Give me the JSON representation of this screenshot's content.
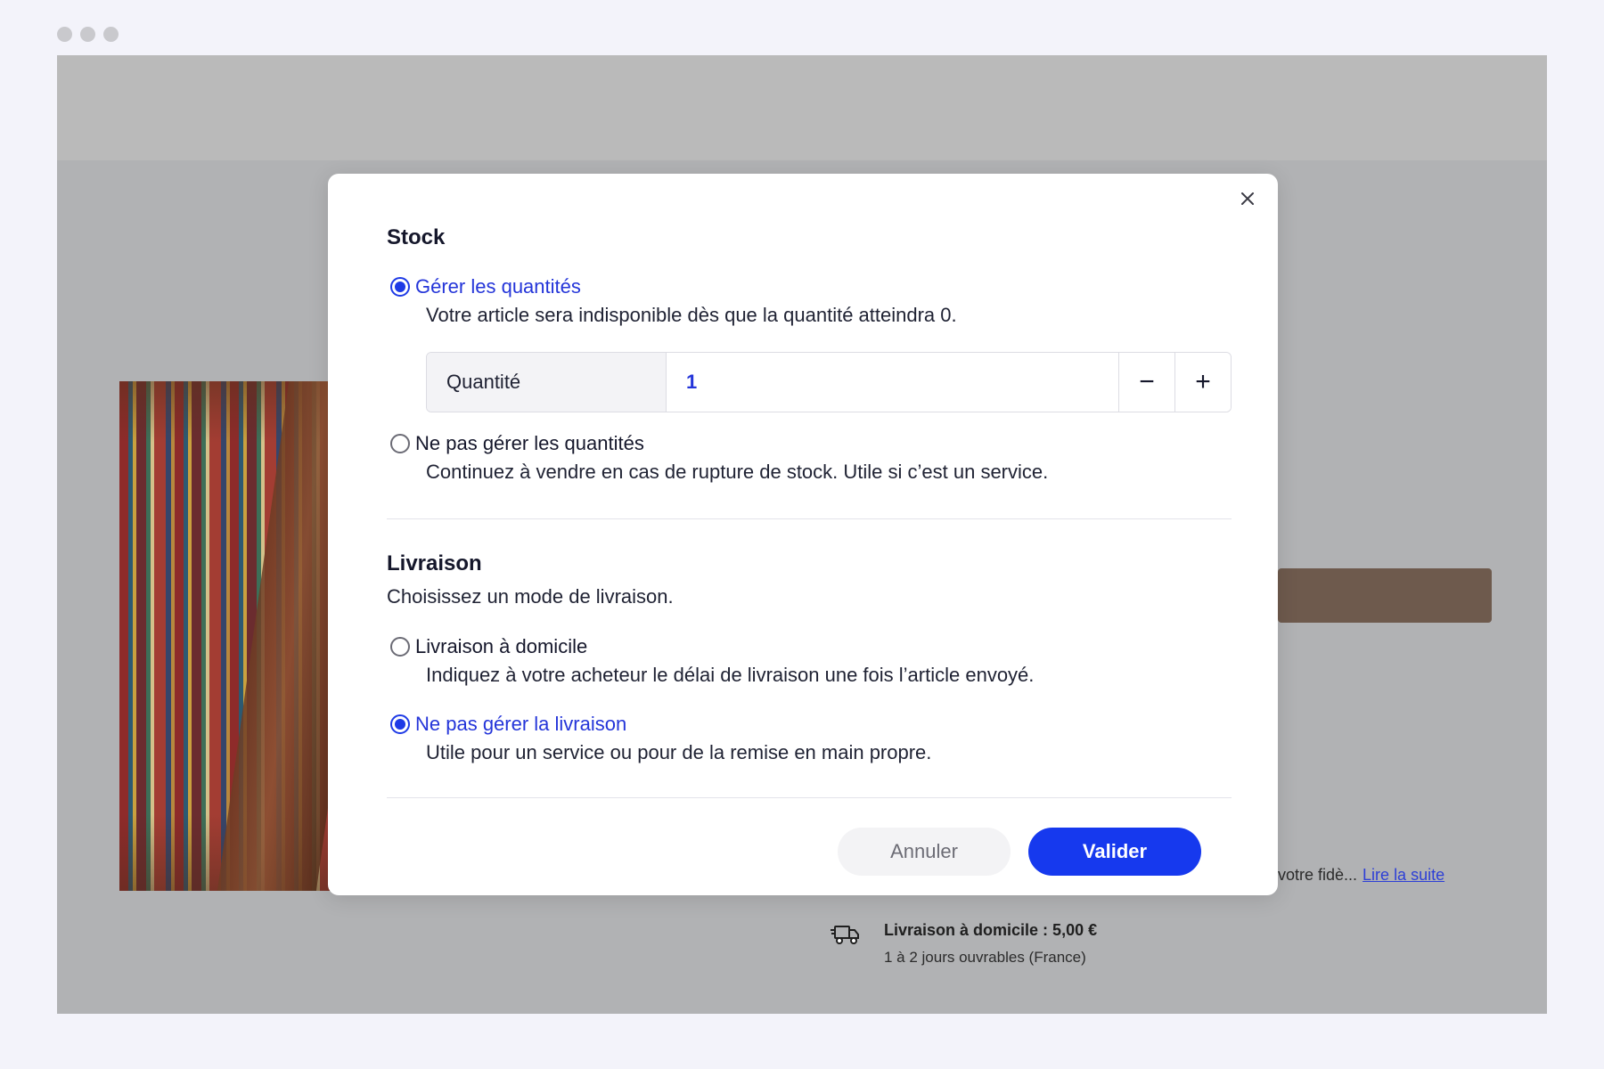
{
  "modal": {
    "stock": {
      "title": "Stock",
      "option_manage": {
        "label": "Gérer les quantités",
        "description": "Votre article sera indisponible dès que la quantité atteindra 0.",
        "checked": true
      },
      "quantity": {
        "label": "Quantité",
        "value": "1",
        "minus": "−",
        "plus": "+"
      },
      "option_no_manage": {
        "label": "Ne pas gérer les quantités",
        "description": "Continuez à vendre en cas de rupture de stock. Utile si c’est un service.",
        "checked": false
      }
    },
    "delivery": {
      "title": "Livraison",
      "subtitle": "Choisissez un mode de livraison.",
      "option_home": {
        "label": "Livraison à domicile",
        "description": "Indiquez à votre acheteur le délai de livraison une fois l’article envoyé.",
        "checked": false
      },
      "option_none": {
        "label": "Ne pas gérer la livraison",
        "description": "Utile pour un service ou pour de la remise en main propre.",
        "checked": true
      }
    },
    "buttons": {
      "cancel": "Annuler",
      "confirm": "Valider"
    }
  },
  "background": {
    "description_snippet": "votre fidè...",
    "read_more": "Lire la suite",
    "delivery_title": "Livraison à domicile : 5,00 €",
    "delivery_subtitle": "1 à 2 jours ouvrables (France)"
  },
  "colors": {
    "accent": "#1639ee",
    "overlay": "#b1b2b4",
    "page_bg": "#f3f3fa"
  }
}
